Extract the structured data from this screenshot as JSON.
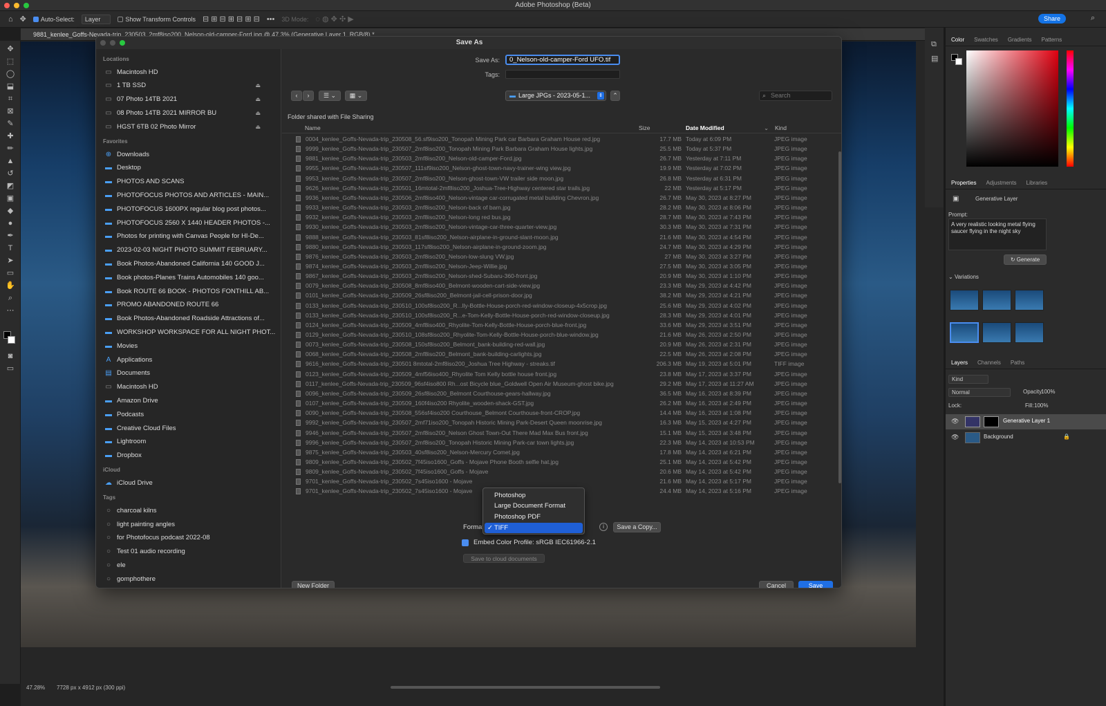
{
  "app": {
    "title": "Adobe Photoshop (Beta)",
    "share_label": "Share"
  },
  "options_bar": {
    "auto_select_label": "Auto-Select:",
    "auto_select_value": "Layer",
    "show_transform_label": "Show Transform Controls",
    "mode_3d_label": "3D Mode:"
  },
  "document": {
    "tab_title": "9881_kenlee_Goffs-Nevada-trip_230503_2mf8iso200_Nelson-old-camper-Ford.jpg @ 47.3% (Generative Layer 1, RGB/8) *"
  },
  "status": {
    "zoom": "47.28%",
    "dimensions": "7728 px x 4912 px (300 ppi)"
  },
  "dialog": {
    "title": "Save As",
    "save_as_label": "Save As:",
    "save_as_value": "0_Nelson-old-camper-Ford UFO.tif",
    "tags_label": "Tags:",
    "location": "Large JPGs - 2023-05-1...",
    "search_placeholder": "Search",
    "shared_note": "Folder shared with File Sharing",
    "columns": {
      "name": "Name",
      "size": "Size",
      "date": "Date Modified",
      "kind": "Kind"
    },
    "files": [
      {
        "name": "0004_kenlee_Goffs-Nevada-trip_230508_56.sf9iso200_Tonopah Mining Park car Barbara Graham House red.jpg",
        "size": "17.7 MB",
        "date": "Today at 6:09 PM",
        "kind": "JPEG image"
      },
      {
        "name": "9999_kenlee_Goffs-Nevada-trip_230507_2mf8iso200_Tonopah Mining Park Barbara Graham House lights.jpg",
        "size": "25.5 MB",
        "date": "Today at 5:37 PM",
        "kind": "JPEG image"
      },
      {
        "name": "9881_kenlee_Goffs-Nevada-trip_230503_2mf8iso200_Nelson-old-camper-Ford.jpg",
        "size": "26.7 MB",
        "date": "Yesterday at 7:11 PM",
        "kind": "JPEG image"
      },
      {
        "name": "9955_kenlee_Goffs-Nevada-trip_230507_111sf9iso200_Nelson-ghost-town-navy-trainer-wing view.jpg",
        "size": "19.9 MB",
        "date": "Yesterday at 7:02 PM",
        "kind": "JPEG image"
      },
      {
        "name": "9953_kenlee_Goffs-Nevada-trip_230507_2mf8iso200_Nelson-ghost-town-VW trailer side moon.jpg",
        "size": "26.8 MB",
        "date": "Yesterday at 6:31 PM",
        "kind": "JPEG image"
      },
      {
        "name": "9626_kenlee_Goffs-Nevada-trip_230501_16mtotal-2mf8iso200_Joshua-Tree-Highway centered star trails.jpg",
        "size": "22 MB",
        "date": "Yesterday at 5:17 PM",
        "kind": "JPEG image"
      },
      {
        "name": "9936_kenlee_Goffs-Nevada-trip_230506_2mf8iso400_Nelson-vintage car-corrugated metal building Chevron.jpg",
        "size": "26.7 MB",
        "date": "May 30, 2023 at 8:27 PM",
        "kind": "JPEG image"
      },
      {
        "name": "9933_kenlee_Goffs-Nevada-trip_230503_2mf8iso200_Nelson-back of barn.jpg",
        "size": "28.2 MB",
        "date": "May 30, 2023 at 8:06 PM",
        "kind": "JPEG image"
      },
      {
        "name": "9932_kenlee_Goffs-Nevada-trip_230503_2mf8iso200_Nelson-long red bus.jpg",
        "size": "28.7 MB",
        "date": "May 30, 2023 at 7:43 PM",
        "kind": "JPEG image"
      },
      {
        "name": "9930_kenlee_Goffs-Nevada-trip_230503_2mf8iso200_Nelson-vintage-car-three-quarter-view.jpg",
        "size": "30.3 MB",
        "date": "May 30, 2023 at 7:31 PM",
        "kind": "JPEG image"
      },
      {
        "name": "9888_kenlee_Goffs-Nevada-trip_230503_81sf8iso200_Nelson-airplane-in-ground-slant-moon.jpg",
        "size": "21.6 MB",
        "date": "May 30, 2023 at 4:54 PM",
        "kind": "JPEG image"
      },
      {
        "name": "9880_kenlee_Goffs-Nevada-trip_230503_117sf8iso200_Nelson-airplane-in-ground-zoom.jpg",
        "size": "24.7 MB",
        "date": "May 30, 2023 at 4:29 PM",
        "kind": "JPEG image"
      },
      {
        "name": "9876_kenlee_Goffs-Nevada-trip_230503_2mf8iso200_Nelson-low-slung VW.jpg",
        "size": "27 MB",
        "date": "May 30, 2023 at 3:27 PM",
        "kind": "JPEG image"
      },
      {
        "name": "9874_kenlee_Goffs-Nevada-trip_230503_2mf8iso200_Nelson-Jeep-Willie.jpg",
        "size": "27.5 MB",
        "date": "May 30, 2023 at 3:05 PM",
        "kind": "JPEG image"
      },
      {
        "name": "9867_kenlee_Goffs-Nevada-trip_230503_2mf8iso200_Nelson-shed-Subaru-360-front.jpg",
        "size": "20.9 MB",
        "date": "May 30, 2023 at 1:10 PM",
        "kind": "JPEG image"
      },
      {
        "name": "0079_kenlee_Goffs-Nevada-trip_230508_8mf8iso400_Belmont-wooden-cart-side-view.jpg",
        "size": "23.3 MB",
        "date": "May 29, 2023 at 4:42 PM",
        "kind": "JPEG image"
      },
      {
        "name": "0101_kenlee_Goffs-Nevada-trip_230509_26sf8iso200_Belmont-jail-cell-prison-door.jpg",
        "size": "38.2 MB",
        "date": "May 29, 2023 at 4:21 PM",
        "kind": "JPEG image"
      },
      {
        "name": "0133_kenlee_Goffs-Nevada-trip_230510_100sf8iso200_R...lly-Bottle-House-porch-red-window-closeup-4x5crop.jpg",
        "size": "25.6 MB",
        "date": "May 29, 2023 at 4:02 PM",
        "kind": "JPEG image"
      },
      {
        "name": "0133_kenlee_Goffs-Nevada-trip_230510_100sf8iso200_R...e-Tom-Kelly-Bottle-House-porch-red-window-closeup.jpg",
        "size": "28.3 MB",
        "date": "May 29, 2023 at 4:01 PM",
        "kind": "JPEG image"
      },
      {
        "name": "0124_kenlee_Goffs-Nevada-trip_230509_4mf8iso400_Rhyolite-Tom-Kelly-Bottle-House-porch-blue-front.jpg",
        "size": "33.6 MB",
        "date": "May 29, 2023 at 3:51 PM",
        "kind": "JPEG image"
      },
      {
        "name": "0129_kenlee_Goffs-Nevada-trip_230510_108sf8iso200_Rhyolite-Tom-Kelly-Bottle-House-porch-blue-window.jpg",
        "size": "21.6 MB",
        "date": "May 26, 2023 at 2:50 PM",
        "kind": "JPEG image"
      },
      {
        "name": "0073_kenlee_Goffs-Nevada-trip_230508_150sf8iso200_Belmont_bank-building-red-wall.jpg",
        "size": "20.9 MB",
        "date": "May 26, 2023 at 2:31 PM",
        "kind": "JPEG image"
      },
      {
        "name": "0068_kenlee_Goffs-Nevada-trip_230508_2mf8iso200_Belmont_bank-building-carlights.jpg",
        "size": "22.5 MB",
        "date": "May 26, 2023 at 2:08 PM",
        "kind": "JPEG image"
      },
      {
        "name": "9616_kenlee_Goffs-Nevada-trip_230501 8mtotal-2mf8iso200_Joshua Tree Highway - streaks.tif",
        "size": "206.3 MB",
        "date": "May 19, 2023 at 5:01 PM",
        "kind": "TIFF image"
      },
      {
        "name": "0123_kenlee_Goffs-Nevada-trip_230509_4mf56iso400_Rhyolite Tom Kelly bottle house front.jpg",
        "size": "23.8 MB",
        "date": "May 17, 2023 at 3:37 PM",
        "kind": "JPEG image"
      },
      {
        "name": "0117_kenlee_Goffs-Nevada-trip_230509_96sf4iso800 Rh...ost Bicycle blue_Goldwell Open Air Museum-ghost bike.jpg",
        "size": "29.2 MB",
        "date": "May 17, 2023 at 11:27 AM",
        "kind": "JPEG image"
      },
      {
        "name": "0096_kenlee_Goffs-Nevada-trip_230509_26sf8iso200_Belmont Courthouse-gears-hallway.jpg",
        "size": "36.5 MB",
        "date": "May 16, 2023 at 8:39 PM",
        "kind": "JPEG image"
      },
      {
        "name": "0107_kenlee_Goffs-Nevada-trip_230509_160f4iso200 Rhyolite_wooden-shack-GST.jpg",
        "size": "26.2 MB",
        "date": "May 16, 2023 at 2:49 PM",
        "kind": "JPEG image"
      },
      {
        "name": "0090_kenlee_Goffs-Nevada-trip_230508_556sf4iso200 Courthouse_Belmont Courthouse-front-CROP.jpg",
        "size": "14.4 MB",
        "date": "May 16, 2023 at 1:08 PM",
        "kind": "JPEG image"
      },
      {
        "name": "9992_kenlee_Goffs-Nevada-trip_230507_2mf71iso200_Tonopah Historic Mining Park-Desert Queen moonrise.jpg",
        "size": "16.3 MB",
        "date": "May 15, 2023 at 4:27 PM",
        "kind": "JPEG image"
      },
      {
        "name": "9946_kenlee_Goffs-Nevada-trip_230507_2mf8iso200_Nelson Ghost Town-Out There Mad Max Bus front.jpg",
        "size": "15.1 MB",
        "date": "May 15, 2023 at 3:48 PM",
        "kind": "JPEG image"
      },
      {
        "name": "9996_kenlee_Goffs-Nevada-trip_230507_2mf8iso200_Tonopah Historic Mining Park-car town lights.jpg",
        "size": "22.3 MB",
        "date": "May 14, 2023 at 10:53 PM",
        "kind": "JPEG image"
      },
      {
        "name": "9875_kenlee_Goffs-Nevada-trip_230503_40sf8iso200_Nelson-Mercury Comet.jpg",
        "size": "17.8 MB",
        "date": "May 14, 2023 at 6:21 PM",
        "kind": "JPEG image"
      },
      {
        "name": "9809_kenlee_Goffs-Nevada-trip_230502_7f45iso1600_Goffs - Mojave Phone Booth selfie hat.jpg",
        "size": "25.1 MB",
        "date": "May 14, 2023 at 5:42 PM",
        "kind": "JPEG image"
      },
      {
        "name": "9809_kenlee_Goffs-Nevada-trip_230502_7f45iso1600_Goffs - Mojave",
        "size": "20.6 MB",
        "date": "May 14, 2023 at 5:42 PM",
        "kind": "JPEG image"
      },
      {
        "name": "9701_kenlee_Goffs-Nevada-trip_230502_7s45iso1600 - Mojave",
        "size": "21.6 MB",
        "date": "May 14, 2023 at 5:17 PM",
        "kind": "JPEG image"
      },
      {
        "name": "9701_kenlee_Goffs-Nevada-trip_230502_7s45iso1600 - Mojave",
        "size": "24.4 MB",
        "date": "May 14, 2023 at 5:16 PM",
        "kind": "JPEG image"
      }
    ],
    "format_label": "Format",
    "format_options": [
      "Photoshop",
      "Large Document Format",
      "Photoshop PDF",
      "TIFF"
    ],
    "format_selected": "TIFF",
    "save_copy_label": "Save a Copy...",
    "embed_label": "Embed Color Profile:  sRGB IEC61966-2.1",
    "cloud_label": "Save to cloud documents",
    "new_folder_label": "New Folder",
    "cancel_label": "Cancel",
    "save_label": "Save"
  },
  "sidebar": {
    "locations_header": "Locations",
    "locations": [
      {
        "label": "Macintosh HD",
        "eject": false
      },
      {
        "label": "1 TB SSD",
        "eject": true
      },
      {
        "label": "07 Photo 14TB 2021",
        "eject": true
      },
      {
        "label": "08 Photo 14TB 2021 MIRROR BU",
        "eject": true
      },
      {
        "label": "HGST 6TB 02 Photo Mirror",
        "eject": true
      }
    ],
    "favorites_header": "Favorites",
    "favorites": [
      "Downloads",
      "Desktop",
      "PHOTOS AND SCANS",
      "PHOTOFOCUS PHOTOS AND ARTICLES - MAIN...",
      "PHOTOFOCUS 1600PX regular blog post photos...",
      "PHOTOFOCUS 2560 X 1440 HEADER PHOTOS -...",
      "Photos for printing with Canvas People for HI-De...",
      "2023-02-03 NIGHT PHOTO SUMMIT FEBRUARY...",
      "Book Photos-Abandoned California 140 GOOD J...",
      "Book photos-Planes Trains Automobiles 140 goo...",
      "Book ROUTE 66 BOOK - PHOTOS FONTHILL AB...",
      "PROMO ABANDONED ROUTE 66",
      "Book Photos-Abandoned Roadside Attractions of...",
      "WORKSHOP WORKSPACE FOR ALL NIGHT PHOT...",
      "Movies",
      "Applications",
      "Documents",
      "Macintosh HD",
      "Amazon Drive",
      "Podcasts",
      "Creative Cloud Files",
      "Lightroom",
      "Dropbox"
    ],
    "icloud_header": "iCloud",
    "icloud": [
      "iCloud Drive"
    ],
    "tags_header": "Tags",
    "tags": [
      "charcoal kilns",
      "light painting angles",
      "for Photofocus podcast 2022-08",
      "Test 01 audio recording",
      "ele",
      "gomphothere"
    ]
  },
  "right_panel": {
    "color_tabs": [
      "Color",
      "Swatches",
      "Gradients",
      "Patterns"
    ],
    "props_tabs": [
      "Properties",
      "Adjustments",
      "Libraries"
    ],
    "layer_type": "Generative Layer",
    "prompt_label": "Prompt:",
    "prompt_text": "A very realistic looking metal flying saucer flying in the night sky",
    "generate_label": "Generate",
    "variations_label": "Variations",
    "layers_tabs": [
      "Layers",
      "Channels",
      "Paths"
    ],
    "kind_label": "Kind",
    "blend_mode": "Normal",
    "opacity_label": "Opacity:",
    "opacity_value": "100%",
    "lock_label": "Lock:",
    "fill_label": "Fill:",
    "fill_value": "100%",
    "layers": [
      {
        "name": "Generative Layer 1"
      },
      {
        "name": "Background"
      }
    ]
  }
}
